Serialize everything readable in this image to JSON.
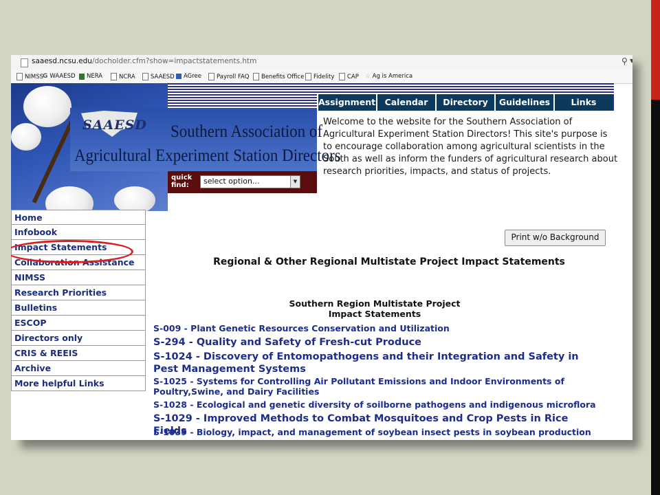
{
  "browser": {
    "url_host": "saaesd.ncsu.edu",
    "url_path": "/docholder.cfm?show=impactstatements.htm",
    "bookmarks": [
      "NIMSS",
      "WAAESD",
      "NERA",
      "NCRA",
      "SAAESD",
      "AGree",
      "Payroll FAQ",
      "Benefits Office",
      "Fidelity",
      "CAP",
      "Ag is America"
    ]
  },
  "logo": {
    "abbr": "SAAESD",
    "line1": "Southern Association of",
    "line2": "Agricultural Experiment Station Directors"
  },
  "quickfind": {
    "label": "quick find:",
    "selected": "select option..."
  },
  "tabs": [
    "Assignments",
    "Calendar",
    "Directory",
    "Guidelines",
    "Links"
  ],
  "welcome": "Welcome to the website for the Southern Association of Agricultural Experiment Station Directors! This site's purpose is to encourage collaboration among agricultural scientists in the South as well as inform the funders of agricultural research about research priorities, impacts, and status of projects.",
  "nav": [
    "Home",
    "Infobook",
    "Impact Statements",
    "Collaboration Assistance",
    "NIMSS",
    "Research Priorities",
    "Bulletins",
    "ESCOP",
    "Directors only",
    "CRIS & REEIS",
    "Archive",
    "More helpful Links"
  ],
  "print_button": "Print w/o Background",
  "main_heading": "Regional & Other Regional Multistate Project Impact Statements",
  "sub_heading_1": "Southern Region Multistate Project",
  "sub_heading_2": "Impact Statements",
  "projects": [
    "S-009 - Plant Genetic Resources Conservation and Utilization",
    "S-294 - Quality and Safety of Fresh-cut Produce",
    "S-1024 - Discovery of Entomopathogens and their Integration and Safety in Pest Management Systems",
    "S-1025 - Systems for Controlling Air Pollutant Emissions and Indoor Environments of Poultry,Swine, and Dairy Facilities",
    "S-1028 - Ecological and genetic diversity of soilborne pathogens and indigenous microflora",
    "S-1029 - Improved Methods to Combat Mosquitoes and Crop Pests in Rice Fields",
    "S-1039 - Biology, impact, and management of soybean insect pests in soybean production"
  ],
  "colors": {
    "accent_red": "#c8241c",
    "nav_blue": "#1c2d7c",
    "tab_bg": "#0d3a5c"
  }
}
